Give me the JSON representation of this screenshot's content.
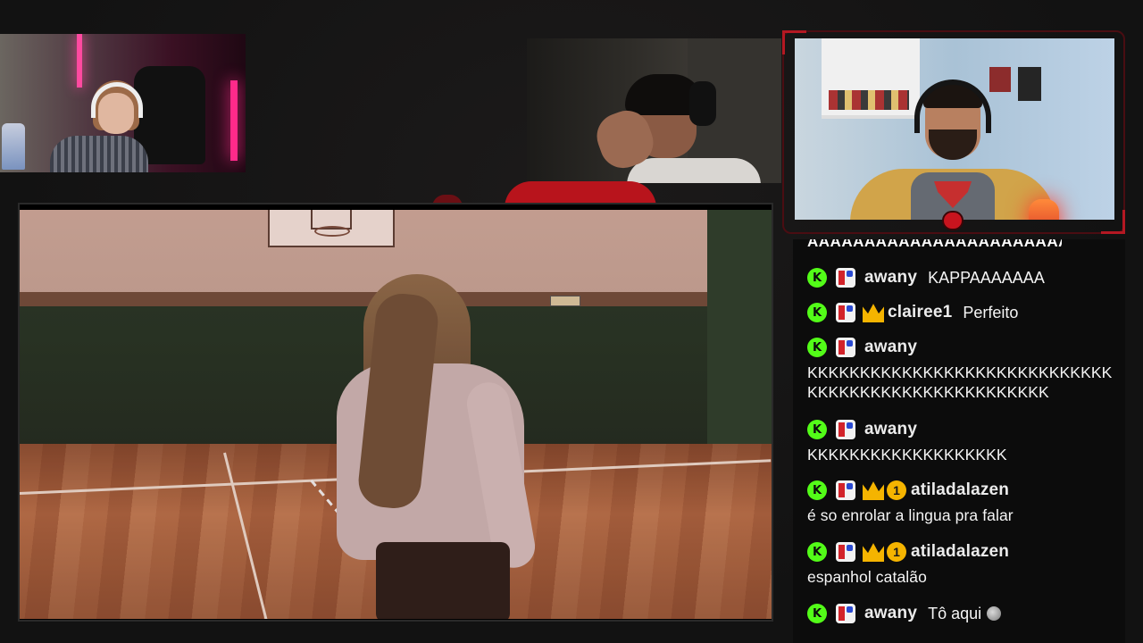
{
  "stream": {
    "main_video": {
      "scene": ""
    },
    "webcams": [
      "cam-left",
      "cam-center",
      "cam-right"
    ]
  },
  "chat": {
    "cutoff_text": "AAAAAAAAAAAAAAAAAAAAAAAA",
    "messages": [
      {
        "username": "awany",
        "badges": [
          "kick",
          "flag"
        ],
        "text": "KAPPAAAAAAA",
        "inline": true
      },
      {
        "username": "clairee1",
        "badges": [
          "kick",
          "flag",
          "crown"
        ],
        "text": "Perfeito",
        "inline": true
      },
      {
        "username": "awany",
        "badges": [
          "kick",
          "flag"
        ],
        "text": "KKKKKKKKKKKKKKKKKKKKKKKKKKKKKKKKKKKKKKKKKKKKKKKKKKKK",
        "inline": false
      },
      {
        "username": "awany",
        "badges": [
          "kick",
          "flag"
        ],
        "text": "KKKKKKKKKKKKKKKKKKK",
        "inline": false
      },
      {
        "username": "atiladalazen",
        "badges": [
          "kick",
          "flag",
          "crown",
          "sub"
        ],
        "sub_count": "1",
        "text": "é so enrolar a lingua pra falar",
        "inline": false
      },
      {
        "username": "atiladalazen",
        "badges": [
          "kick",
          "flag",
          "crown",
          "sub"
        ],
        "sub_count": "1",
        "text": "espanhol catalão",
        "inline": false
      },
      {
        "username": "awany",
        "badges": [
          "kick",
          "flag"
        ],
        "text": "Tô aqui",
        "inline": true,
        "emote": "face-emote"
      }
    ],
    "kick_badge_letter": "K",
    "colors": {
      "kick_green": "#53fc18",
      "crown_gold": "#f5b400",
      "frame_red": "#b41822"
    }
  }
}
